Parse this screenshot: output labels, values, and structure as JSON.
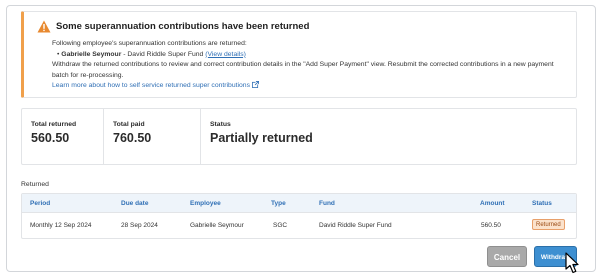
{
  "alert": {
    "title": "Some superannuation contributions have been returned",
    "intro": "Following employee's superannuation contributions are returned:",
    "employee_name": "Gabrielle Seymour",
    "employee_fund": " - David Riddle Super Fund",
    "view_details": "(View details)",
    "instructions": "Withdraw the returned contributions to review and correct contribution details in the \"Add Super Payment\" view. Resubmit the corrected contributions in a new payment batch for re-processing.",
    "learn_more": "Learn more about how to self service returned super contributions",
    "accent_color": "#f0a04b",
    "icon": "warning-icon"
  },
  "summary": {
    "total_returned_label": "Total returned",
    "total_returned_value": "560.50",
    "total_paid_label": "Total paid",
    "total_paid_value": "760.50",
    "status_label": "Status",
    "status_value": "Partially returned"
  },
  "returned": {
    "title": "Returned",
    "columns": {
      "period": "Period",
      "due_date": "Due date",
      "employee": "Employee",
      "type": "Type",
      "fund": "Fund",
      "amount": "Amount",
      "status": "Status"
    },
    "rows": [
      {
        "period": "Monthly 12 Sep 2024",
        "due_date": "28 Sep 2024",
        "employee": "Gabrielle Seymour",
        "type": "SGC",
        "fund": "David Riddle Super Fund",
        "amount": "560.50",
        "status": "Returned"
      }
    ]
  },
  "actions": {
    "cancel_label": "Cancel",
    "withdraw_label": "Withdraw",
    "primary_color": "#3d8fd1"
  }
}
